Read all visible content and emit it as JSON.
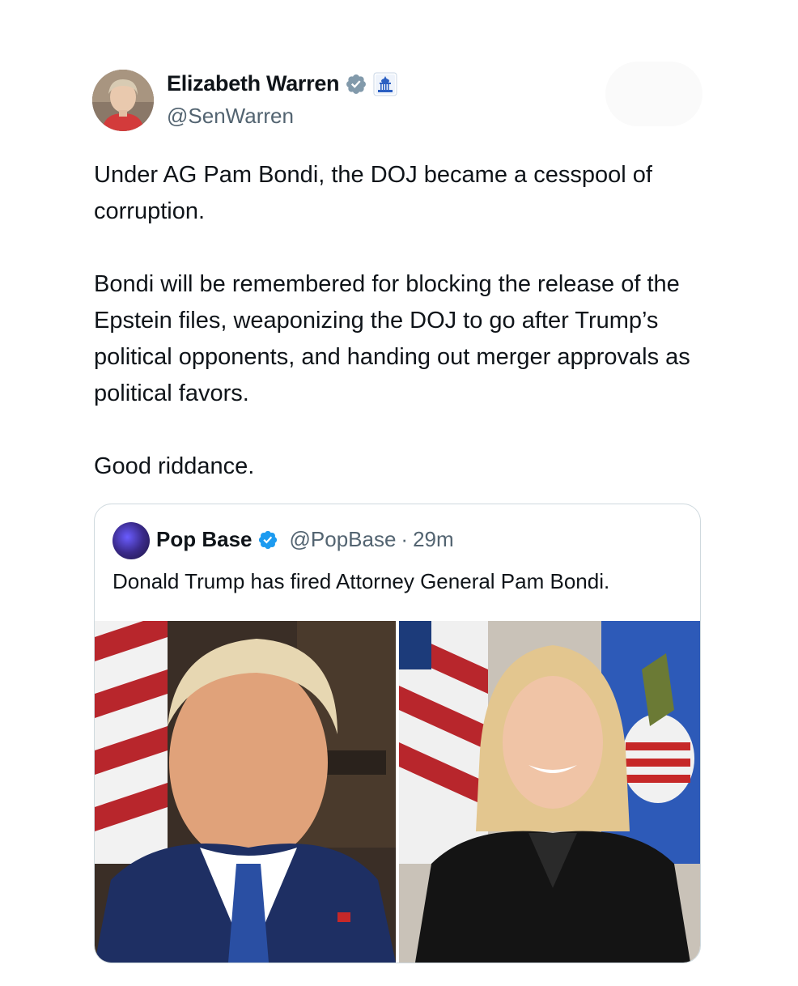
{
  "author": {
    "name": "Elizabeth Warren",
    "handle": "@SenWarren",
    "verified_icon": "verified-badge-icon",
    "affiliation_icon": "government-capitol-icon"
  },
  "tweet": {
    "paragraphs": [
      "Under AG Pam Bondi, the DOJ became a cesspool of corruption.",
      "Bondi will be remembered for blocking the release of the Epstein files, weaponizing the DOJ to go after Trump’s political opponents, and handing out merger approvals as political favors.",
      "Good riddance."
    ]
  },
  "quoted": {
    "name": "Pop Base",
    "handle": "@PopBase",
    "separator": "·",
    "time": "29m",
    "text": "Donald Trump has fired Attorney General Pam Bondi.",
    "media": [
      "portrait-photo-man",
      "portrait-photo-woman"
    ]
  },
  "colors": {
    "text": "#0f1419",
    "secondary": "#536471",
    "verified": "#829aab",
    "quote_border": "#cfd9de",
    "blue_check": "#1d9bf0"
  }
}
